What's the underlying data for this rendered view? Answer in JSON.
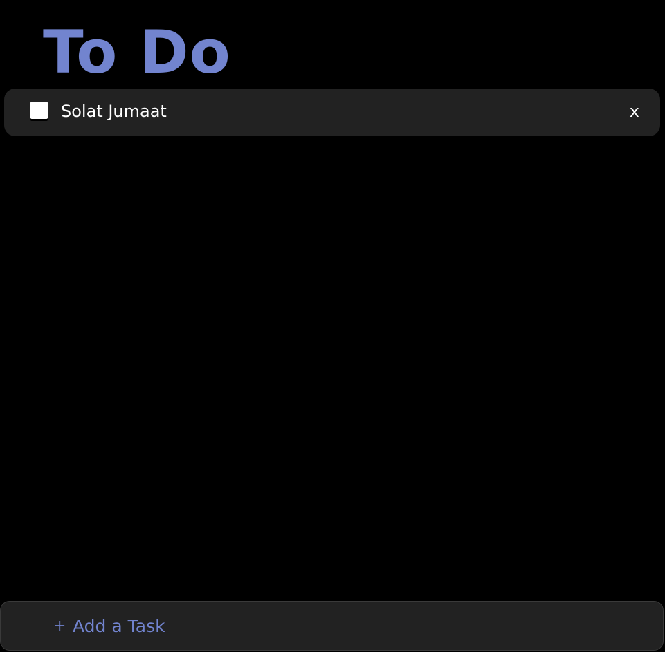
{
  "colors": {
    "background": "#000000",
    "accent": "#7284cf",
    "card": "#222222",
    "text": "#ffffff"
  },
  "header": {
    "title": "To Do"
  },
  "tasks": [
    {
      "label": "Solat Jumaat",
      "checked": false,
      "delete_label": "x"
    }
  ],
  "add_task": {
    "icon_glyph": "+",
    "icon_name": "plus-icon",
    "placeholder": "Add a Task",
    "value": ""
  }
}
